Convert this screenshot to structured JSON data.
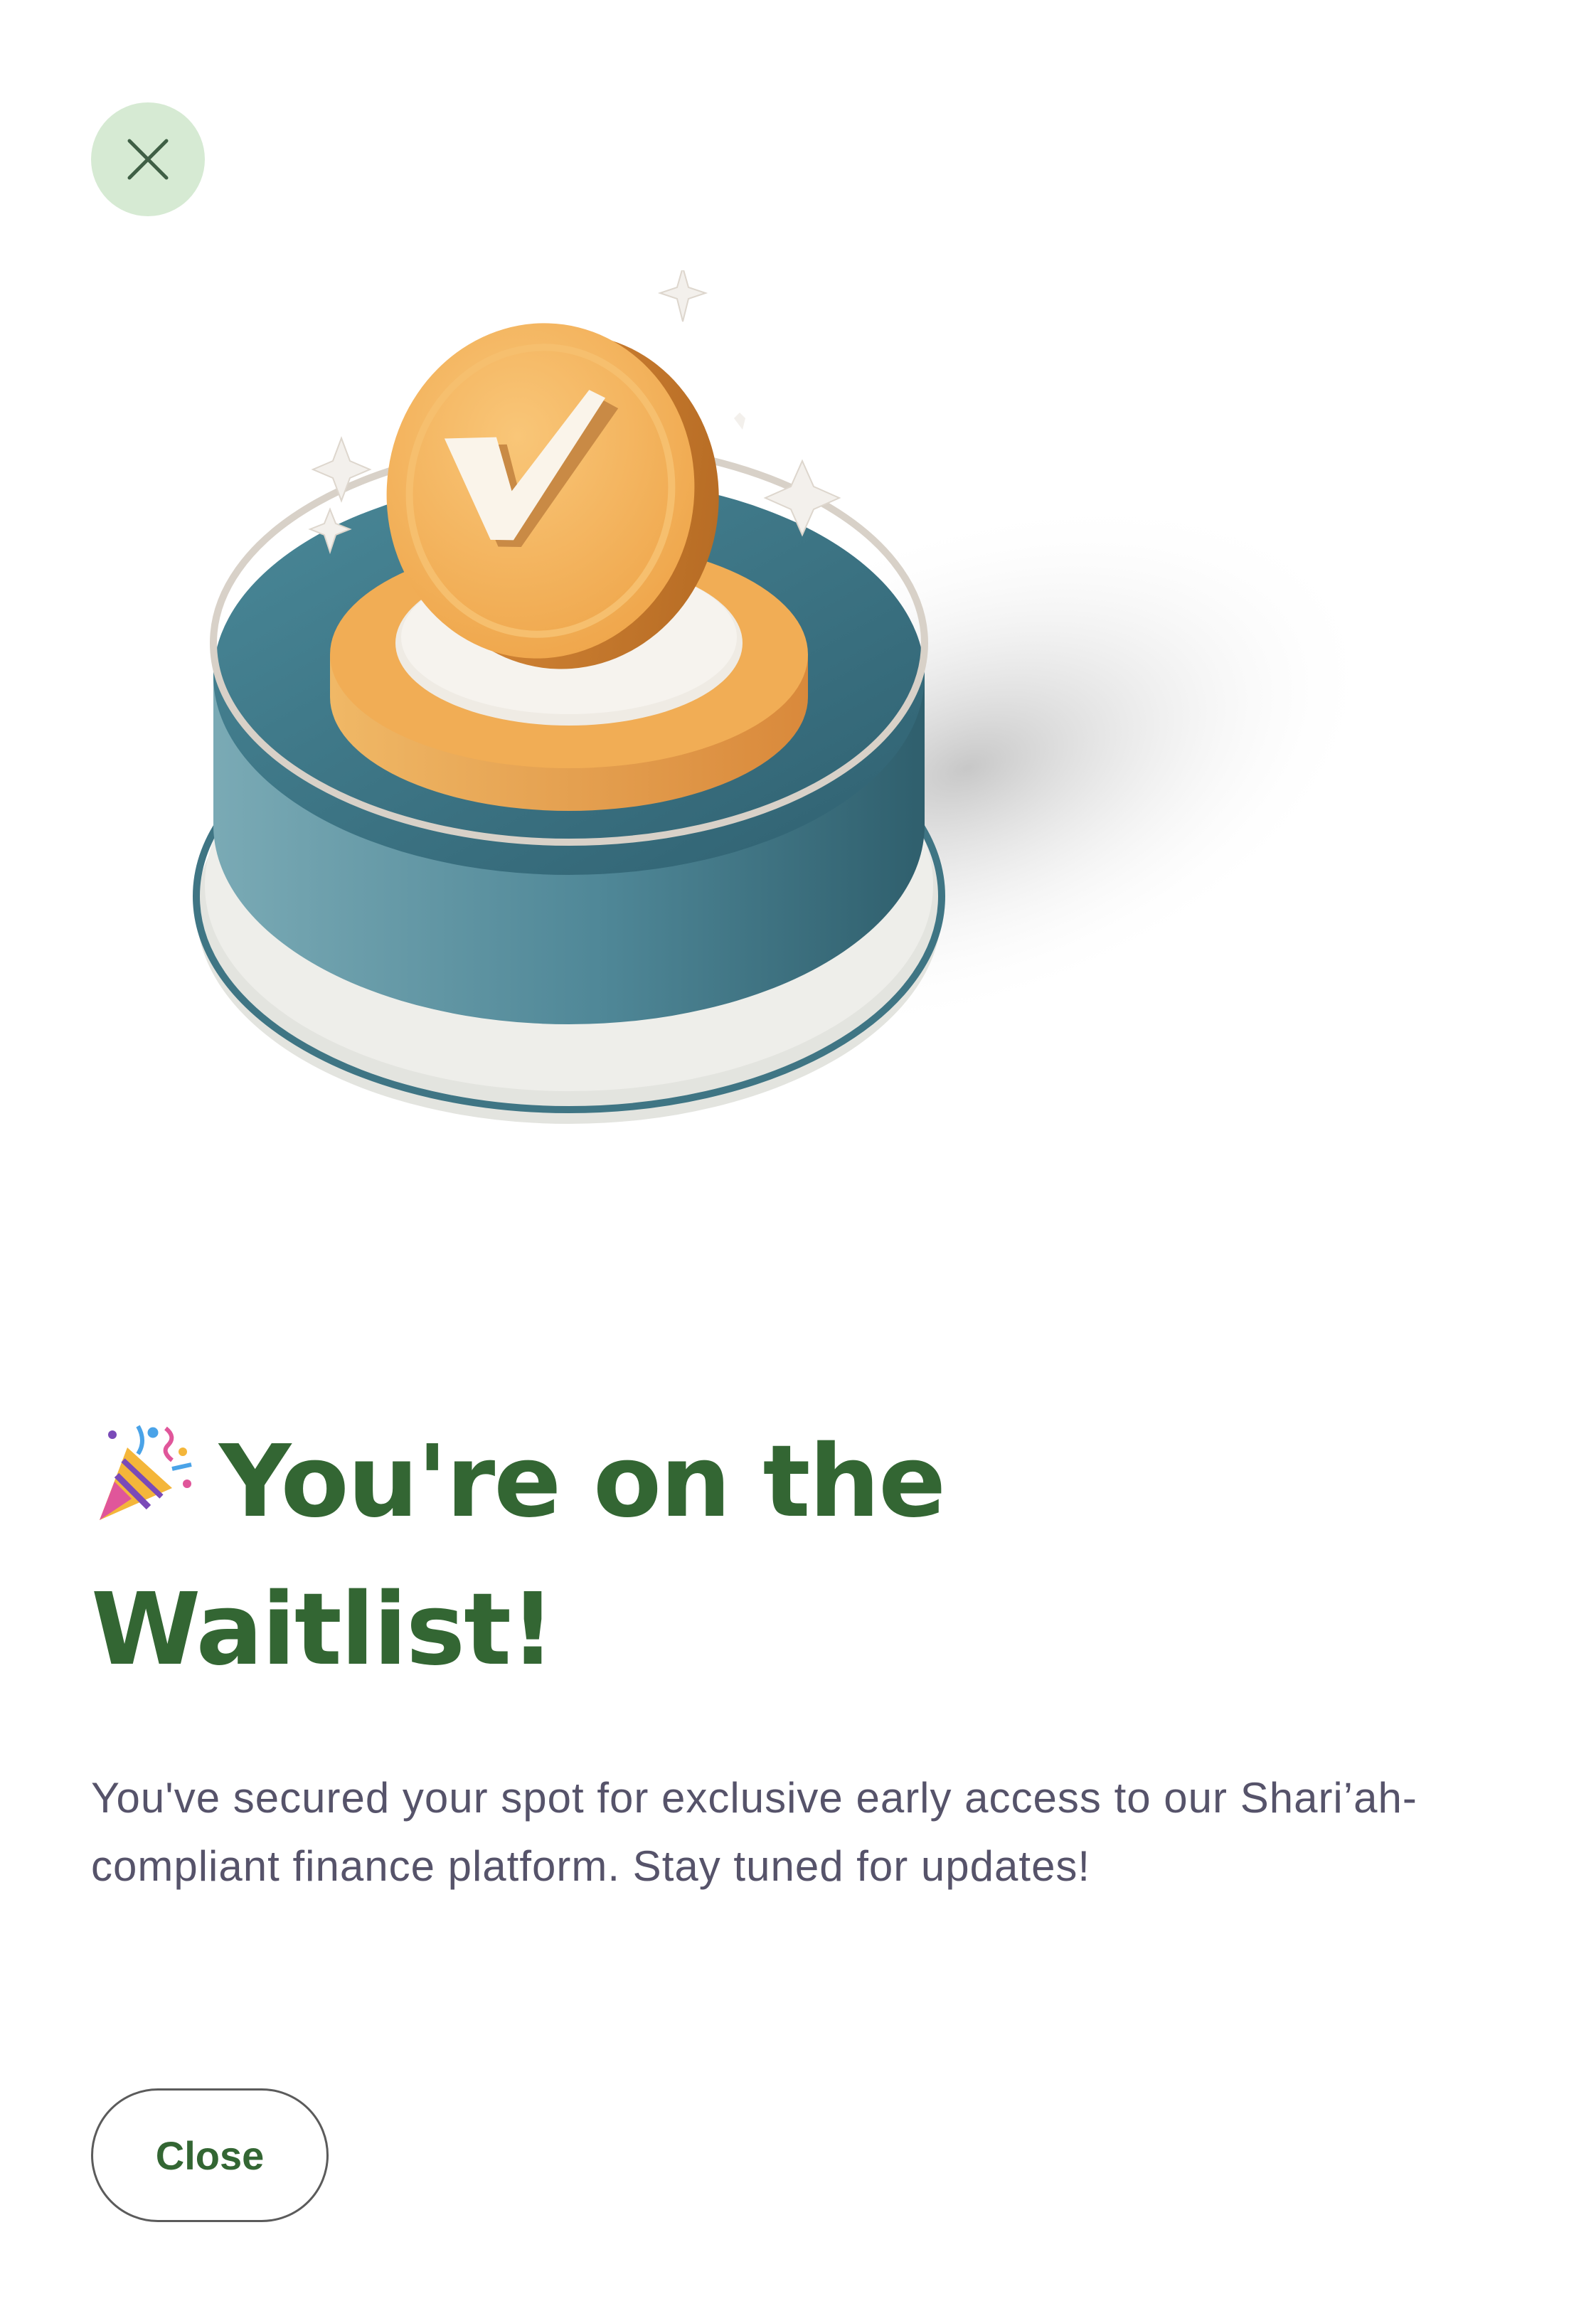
{
  "dialog": {
    "close_icon": "close-icon",
    "illustration_icon": "verified-check-coin-on-podium-illustration",
    "headline_icon": "party-popper-icon",
    "headline_line1": "You're on the",
    "headline_line2": "Waitlist!",
    "description": "You've secured your spot for exclusive early access to our Shari’ah-compliant finance platform. Stay tuned for updates!",
    "close_button_label": "Close"
  },
  "colors": {
    "headline": "#336633",
    "close_circle_bg": "#d6ead3",
    "body_text": "#56536a",
    "coin": "#f2b15a",
    "podium": "#4a8595"
  }
}
